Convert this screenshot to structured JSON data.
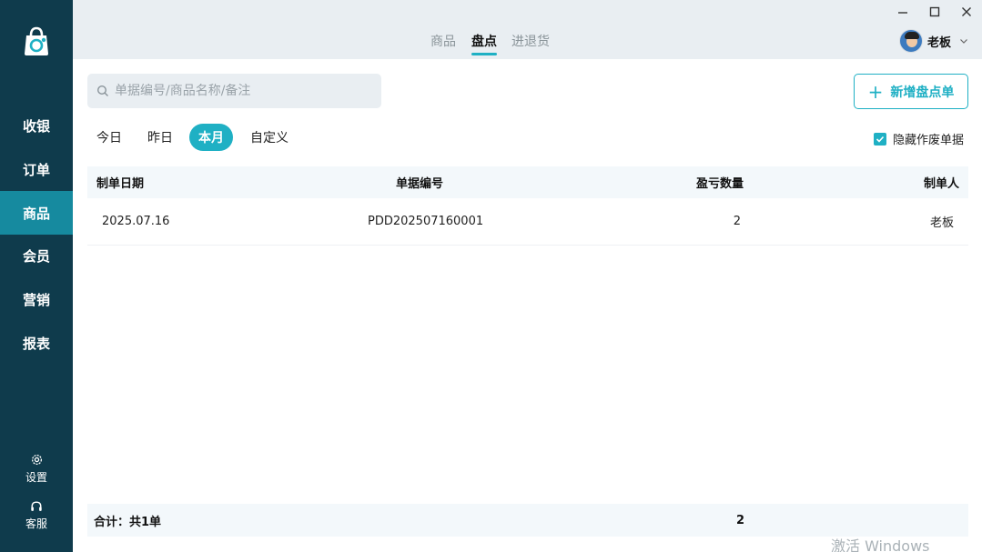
{
  "sidebar": {
    "items": [
      {
        "label": "收银",
        "active": false
      },
      {
        "label": "订单",
        "active": false
      },
      {
        "label": "商品",
        "active": true
      },
      {
        "label": "会员",
        "active": false
      },
      {
        "label": "营销",
        "active": false
      },
      {
        "label": "报表",
        "active": false
      }
    ],
    "settings_label": "设置",
    "service_label": "客服"
  },
  "header": {
    "tabs": [
      {
        "label": "商品",
        "active": false
      },
      {
        "label": "盘点",
        "active": true
      },
      {
        "label": "进退货",
        "active": false
      }
    ],
    "user_name": "老板"
  },
  "toolbar": {
    "search_placeholder": "单据编号/商品名称/备注",
    "add_button_label": "新增盘点单",
    "date_filters": [
      {
        "label": "今日",
        "active": false
      },
      {
        "label": "昨日",
        "active": false
      },
      {
        "label": "本月",
        "active": true
      },
      {
        "label": "自定义",
        "active": false
      }
    ],
    "hide_void_label": "隐藏作废单据",
    "hide_void_checked": true
  },
  "table": {
    "columns": [
      "制单日期",
      "单据编号",
      "盈亏数量",
      "制单人"
    ],
    "rows": [
      {
        "date": "2025.07.16",
        "number": "PDD202507160001",
        "qty": "2",
        "creator": "老板"
      }
    ],
    "footer": {
      "label": "合计：共1单",
      "qty_total": "2"
    }
  },
  "watermark": "激活 Windows",
  "colors": {
    "sidebar_bg": "#0f3b4c",
    "active_nav": "#168a9f",
    "accent": "#1fb0c4"
  }
}
